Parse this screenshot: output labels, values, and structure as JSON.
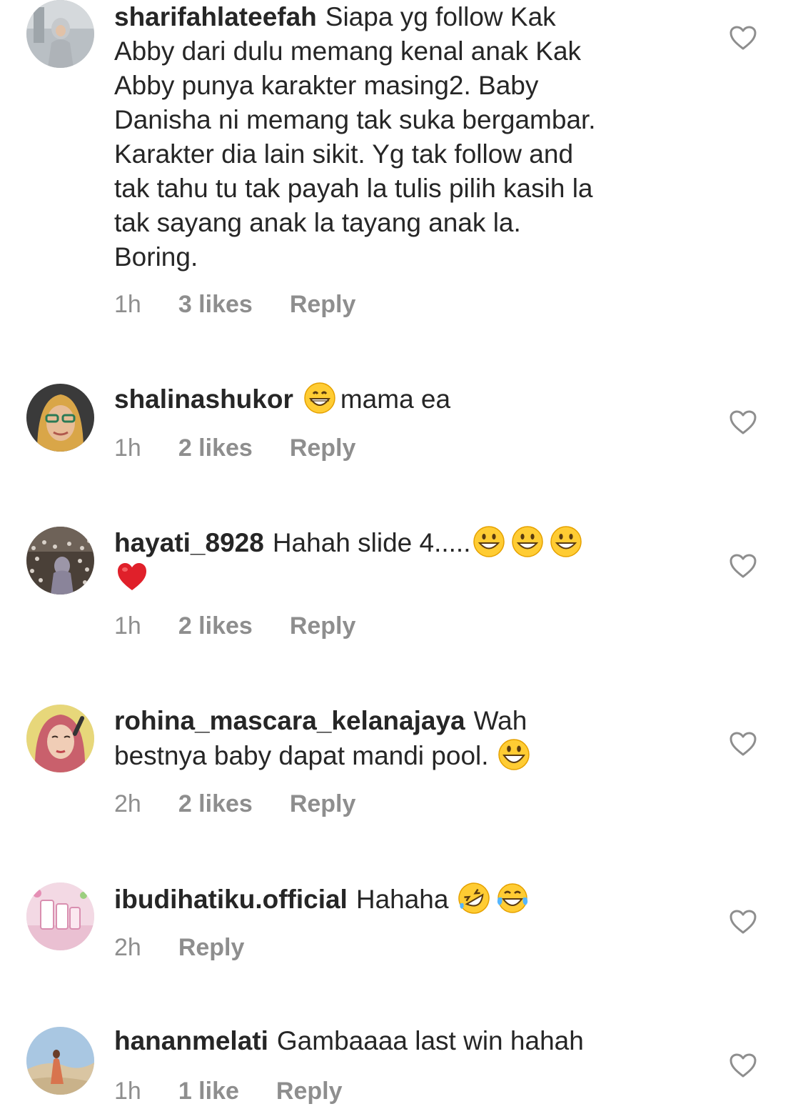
{
  "comments": [
    {
      "username": "sharifahlateefah",
      "text_lines": [
        "Siapa yg follow Kak",
        "Abby dari dulu memang kenal anak Kak",
        "Abby punya karakter masing2. Baby",
        "Danisha ni memang tak suka bergambar.",
        "Karakter dia lain sikit. Yg tak follow and",
        "tak tahu tu tak payah la tulis pilih kasih la",
        "tak sayang anak la tayang anak la.",
        "Boring."
      ],
      "time": "1h",
      "likes": "3 likes",
      "reply": "Reply",
      "avatar_icon": "avatar-hijab-street"
    },
    {
      "username": "shalinashukor",
      "emoji": [
        "grinning-face-emoji"
      ],
      "text": "mama ea",
      "time": "1h",
      "likes": "2 likes",
      "reply": "Reply",
      "avatar_icon": "avatar-hijab-glasses"
    },
    {
      "username": "hayati_8928",
      "text": "Hahah slide 4.....",
      "emoji": [
        "smiley-emoji",
        "smiley-emoji",
        "smiley-emoji"
      ],
      "emoji_line2": [
        "red-heart-emoji"
      ],
      "time": "1h",
      "likes": "2 likes",
      "reply": "Reply",
      "avatar_icon": "avatar-field-flowers"
    },
    {
      "username": "rohina_mascara_kelanajaya",
      "text_line1": "Wah",
      "text_line2": "bestnya baby dapat mandi pool.",
      "emoji": [
        "big-smile-emoji"
      ],
      "time": "2h",
      "likes": "2 likes",
      "reply": "Reply",
      "avatar_icon": "avatar-pink-hijab"
    },
    {
      "username": "ibudihatiku.official",
      "text": "Hahaha",
      "emoji": [
        "rolling-laughing-emoji",
        "tears-of-joy-emoji"
      ],
      "time": "2h",
      "reply": "Reply",
      "avatar_icon": "avatar-product-pink"
    },
    {
      "username": "hananmelati",
      "text": "Gambaaaa last win hahah",
      "time": "1h",
      "likes": "1 like",
      "reply": "Reply",
      "avatar_icon": "avatar-desert"
    }
  ],
  "colors": {
    "text": "#262626",
    "meta": "#8e8e8e",
    "heart_outline": "#8e8e8e"
  }
}
